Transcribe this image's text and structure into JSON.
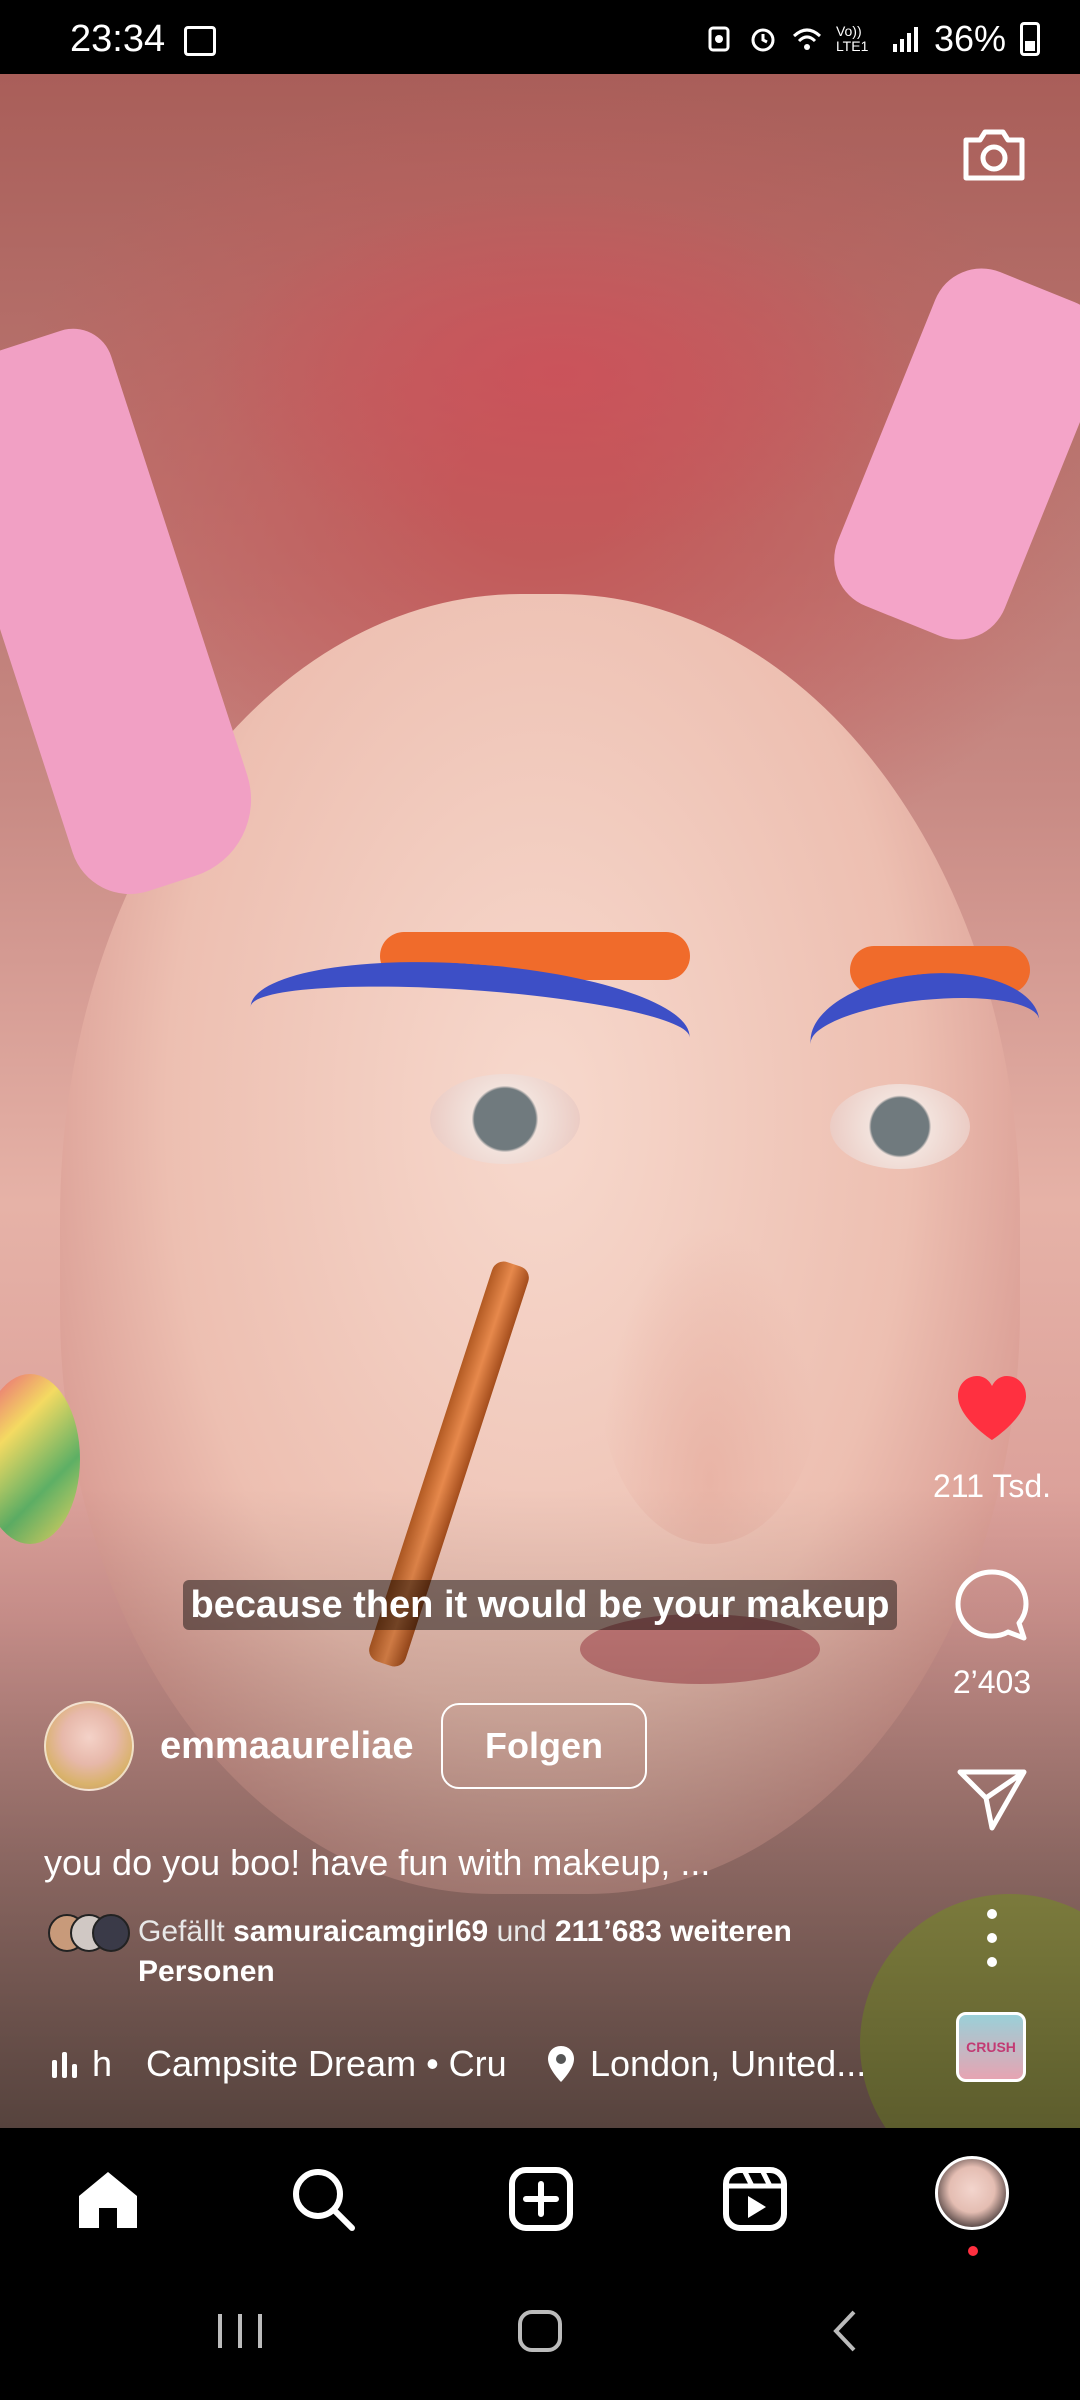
{
  "status_bar": {
    "time": "23:34",
    "network": "Vo)) LTE1",
    "battery": "36%"
  },
  "video": {
    "subtitle": "because then it would be your makeup"
  },
  "actions": {
    "likes": "211 Tsd.",
    "comments": "2’403"
  },
  "post": {
    "username": "emmaaureliae",
    "follow_label": "Folgen",
    "caption": "you do you boo! have fun with makeup, ...",
    "likes_prefix": "Gefällt",
    "liked_by": "samuraicamgirl69",
    "likes_and": "und",
    "likes_others": "211’683 weiteren Personen",
    "music_fade": "h",
    "music_title": "Campsite Dream • Cru",
    "location": "London, Unıted...",
    "audio_thumb_text": "CRUSH"
  },
  "colors": {
    "like": "#ff3040",
    "background": "#000000"
  },
  "icons": [
    "camera-icon",
    "heart-icon",
    "comment-icon",
    "share-icon",
    "more-icon",
    "home-icon",
    "search-icon",
    "create-icon",
    "reels-icon"
  ]
}
